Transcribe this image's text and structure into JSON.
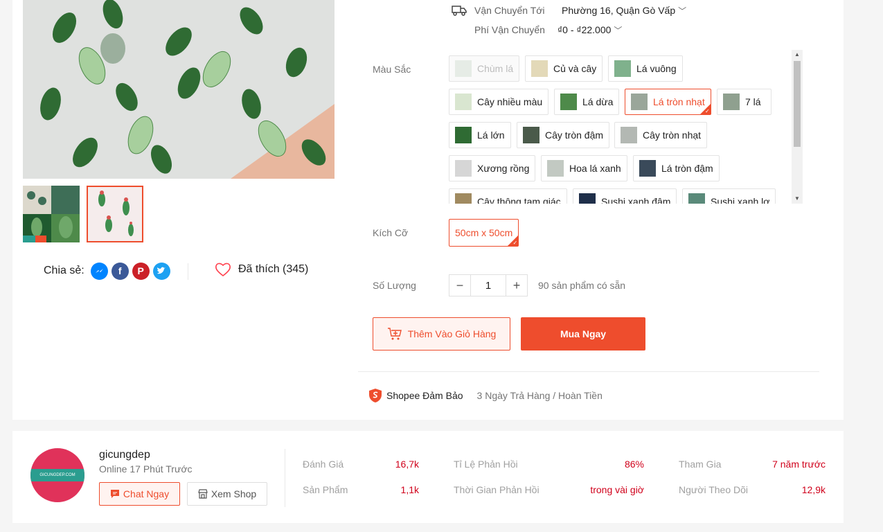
{
  "share": {
    "label": "Chia sẻ:"
  },
  "likes": {
    "label": "Đã thích (345)"
  },
  "shipping": {
    "to_label": "Vận Chuyển Tới",
    "to_value": "Phường 16, Quận Gò Vấp",
    "fee_label": "Phí Vận Chuyển",
    "fee_value": "₫0 - ₫22.000"
  },
  "variations": {
    "color_label": "Màu Sắc",
    "colors": [
      {
        "label": "Chùm lá",
        "state": "disabled"
      },
      {
        "label": "Củ và cây",
        "state": "normal"
      },
      {
        "label": "Lá vuông",
        "state": "normal"
      },
      {
        "label": "Cây nhiều màu",
        "state": "normal"
      },
      {
        "label": "Lá dừa",
        "state": "normal"
      },
      {
        "label": "Lá tròn nhạt",
        "state": "selected"
      },
      {
        "label": "7 lá",
        "state": "normal"
      },
      {
        "label": "Lá lớn",
        "state": "normal"
      },
      {
        "label": "Cây tròn đậm",
        "state": "normal"
      },
      {
        "label": "Cây tròn nhạt",
        "state": "normal"
      },
      {
        "label": "Xương rồng",
        "state": "normal"
      },
      {
        "label": "Hoa lá xanh",
        "state": "normal"
      },
      {
        "label": "Lá tròn đậm",
        "state": "normal"
      },
      {
        "label": "Cây thông tam giác",
        "state": "normal"
      },
      {
        "label": "Sushi xanh đậm",
        "state": "normal"
      },
      {
        "label": "Sushi xanh lợ",
        "state": "normal"
      }
    ],
    "size_label": "Kích Cỡ",
    "sizes": [
      {
        "label": "50cm x 50cm",
        "state": "selected"
      }
    ]
  },
  "quantity": {
    "label": "Số Lượng",
    "minus": "−",
    "value": "1",
    "plus": "+",
    "stock": "90 sản phẩm có sẵn"
  },
  "actions": {
    "add_to_cart": "Thêm Vào Giỏ Hàng",
    "buy_now": "Mua Ngay"
  },
  "guarantee": {
    "name": "Shopee Đảm Bảo",
    "desc": "3 Ngày Trả Hàng / Hoàn Tiền"
  },
  "shop": {
    "avatar_text": "GICUNGDEP.COM",
    "name": "gicungdep",
    "online": "Online 17 Phút Trước",
    "chat": "Chat Ngay",
    "view_shop": "Xem Shop",
    "stats": {
      "rating_label": "Đánh Giá",
      "rating_value": "16,7k",
      "products_label": "Sản Phẩm",
      "products_value": "1,1k",
      "response_rate_label": "Tỉ Lệ Phản Hồi",
      "response_rate_value": "86%",
      "response_time_label": "Thời Gian Phản Hồi",
      "response_time_value": "trong vài giờ",
      "joined_label": "Tham Gia",
      "joined_value": "7 năm trước",
      "followers_label": "Người Theo Dõi",
      "followers_value": "12,9k"
    }
  },
  "colors": {
    "accent": "#ee4d2d",
    "stat_value": "#d0011b"
  }
}
